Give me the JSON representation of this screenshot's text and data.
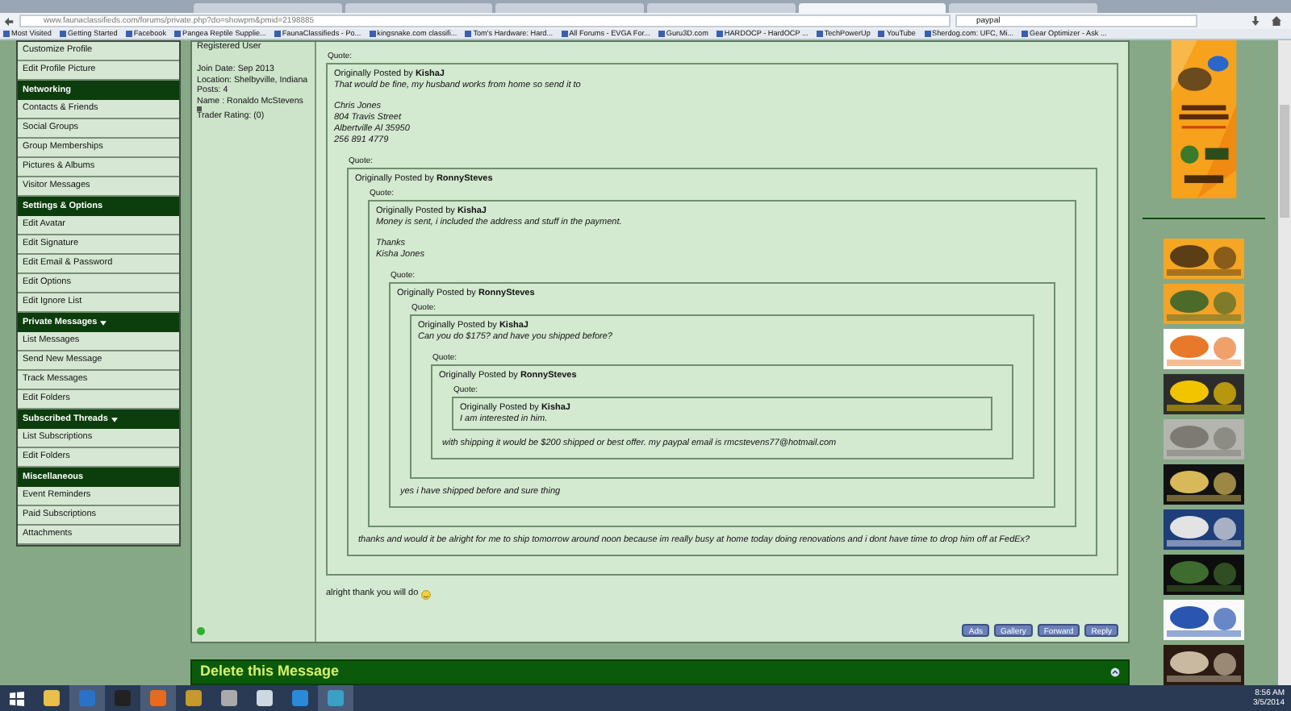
{
  "browser": {
    "tabs": [
      {
        "selected": false
      },
      {
        "selected": false
      },
      {
        "selected": false
      },
      {
        "selected": false
      },
      {
        "selected": true
      },
      {
        "selected": false
      }
    ],
    "url": "www.faunaclassifieds.com/forums/private.php?do=showpm&pmid=2198885",
    "search": "paypal",
    "bookmarks": [
      "Most Visited",
      "Getting Started",
      "Facebook",
      "Pangea Reptile Supplie...",
      "FaunaClassifieds - Po...",
      "kingsnake.com classifi...",
      "Tom's Hardware: Hard...",
      "All Forums - EVGA For...",
      "Guru3D.com",
      "HARDOCP - HardOCP ...",
      "TechPowerUp",
      "YouTube",
      "Sherdog.com: UFC, Mi...",
      "Gear Optimizer - Ask ..."
    ]
  },
  "sidebar": [
    {
      "items": [
        "Customize Profile",
        "Edit Profile Picture"
      ]
    },
    {
      "title": "Networking",
      "dropdown": false,
      "items": [
        "Contacts & Friends",
        "Social Groups",
        "Group Memberships",
        "Pictures & Albums",
        "Visitor Messages"
      ]
    },
    {
      "title": "Settings & Options",
      "dropdown": false,
      "items": [
        "Edit Avatar",
        "Edit Signature",
        "Edit Email & Password",
        "Edit Options",
        "Edit Ignore List"
      ]
    },
    {
      "title": "Private Messages",
      "dropdown": true,
      "items": [
        "List Messages",
        "Send New Message",
        "Track Messages",
        "Edit Folders"
      ]
    },
    {
      "title": "Subscribed Threads",
      "dropdown": true,
      "items": [
        "List Subscriptions",
        "Edit Folders"
      ]
    },
    {
      "title": "Miscellaneous",
      "dropdown": false,
      "items": [
        "Event Reminders",
        "Paid Subscriptions",
        "Attachments"
      ]
    }
  ],
  "user": {
    "rank": "Registered User",
    "details": [
      "Join Date: Sep 2013",
      "Location: Shelbyville, Indiana",
      "Posts: 4",
      "Name : Ronaldo McStevens"
    ],
    "trader": "Trader Rating: (0)",
    "online": true
  },
  "message": {
    "quote": {
      "label": "Quote:",
      "posted_by": "Originally Posted by",
      "author": "KishaJ",
      "paragraphs": [
        [
          "That would be fine, my husband works from home so send it to"
        ],
        [
          "Chris Jones",
          "804 Travis Street",
          "Albertville Al 35950",
          "256 891 4779"
        ]
      ],
      "quote": {
        "label": "Quote:",
        "posted_by": "Originally Posted by",
        "author": "RonnySteves",
        "quote": {
          "label": "Quote:",
          "posted_by": "Originally Posted by",
          "author": "KishaJ",
          "paragraphs": [
            [
              "Money is sent, i included the address and stuff in the payment."
            ],
            [
              "Thanks",
              "Kisha Jones"
            ]
          ],
          "quote": {
            "label": "Quote:",
            "posted_by": "Originally Posted by",
            "author": "RonnySteves",
            "quote": {
              "label": "Quote:",
              "posted_by": "Originally Posted by",
              "author": "KishaJ",
              "paragraphs": [
                [
                  "Can you do $175? and have you shipped before?"
                ]
              ],
              "quote": {
                "label": "Quote:",
                "posted_by": "Originally Posted by",
                "author": "RonnySteves",
                "quote": {
                  "label": "Quote:",
                  "posted_by": "Originally Posted by",
                  "author": "KishaJ",
                  "paragraphs": [
                    [
                      "I am interested in him."
                    ]
                  ]
                },
                "after": [
                  "with shipping it would be $200 shipped or best offer. my paypal email is rmcstevens77@hotmail.com"
                ]
              }
            },
            "after": [
              "yes i have shipped before and sure thing"
            ]
          }
        },
        "after": [
          "thanks and would it be alright for me to ship tomorrow around noon because im really busy at home today doing renovations and i dont have time to drop him off at FedEx?"
        ]
      }
    },
    "reply": "alright thank you will do",
    "buttons": [
      "Ads",
      "Gallery",
      "Forward",
      "Reply"
    ]
  },
  "delete_bar": {
    "title": "Delete this Message"
  },
  "taskbar": {
    "time": "8:56 AM",
    "date": "3/5/2014"
  }
}
